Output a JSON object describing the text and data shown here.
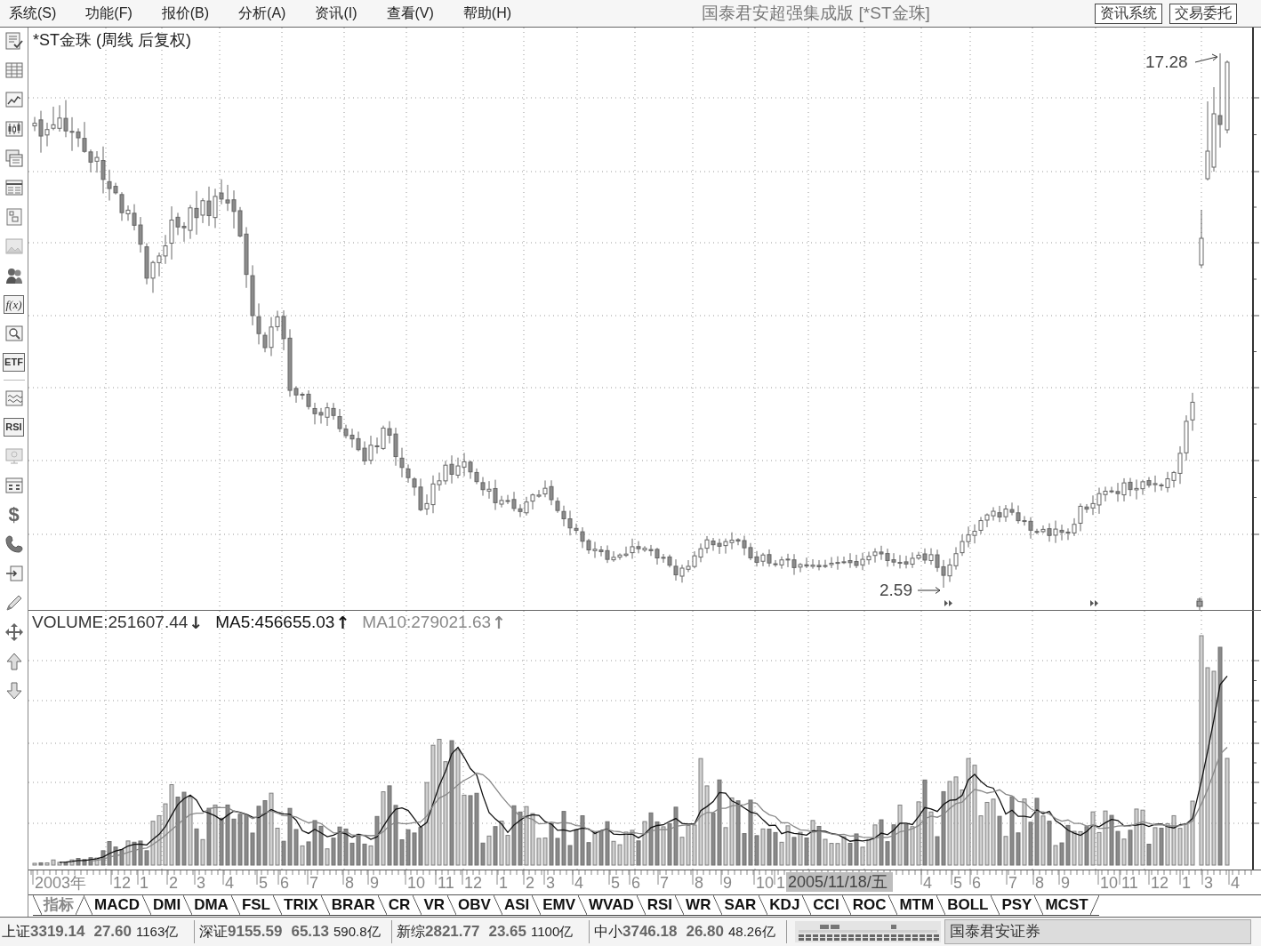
{
  "menu_bar": {
    "items": [
      "系统(S)",
      "功能(F)",
      "报价(B)",
      "分析(A)",
      "资讯(I)",
      "查看(V)",
      "帮助(H)"
    ],
    "title": "国泰君安超强集成版 [*ST金珠]",
    "buttons": [
      "资讯系统",
      "交易委托"
    ]
  },
  "toolbar": {
    "labels": [
      {
        "text": "f(x)",
        "kind": "formula"
      },
      {
        "text": "ETF",
        "kind": "tile"
      },
      {
        "text": "RSI",
        "kind": "tile"
      },
      {
        "text": "$",
        "kind": "glyph"
      }
    ]
  },
  "price_chart": {
    "title": "*ST金珠 (周线 后复权)",
    "high_label": "17.28",
    "low_label": "2.59"
  },
  "volume_chart": {
    "indicators": [
      {
        "text": "VOLUME:251607.44",
        "arrow": "↓",
        "color": "#333333"
      },
      {
        "text": "MA5:456655.03",
        "arrow": "↑",
        "color": "#111111"
      },
      {
        "text": "MA10:279021.63",
        "arrow": "↑",
        "color": "#888888"
      }
    ]
  },
  "x_axis": {
    "labels": [
      "2003年",
      "12",
      "1",
      "2",
      "3",
      "4",
      "5",
      "6",
      "7",
      "8",
      "9",
      "10",
      "11",
      "12",
      "1",
      "2",
      "3",
      "4",
      "5",
      "6",
      "7",
      "8",
      "9",
      "10",
      "1",
      "4",
      "5",
      "6",
      "7",
      "8",
      "9",
      "10",
      "11",
      "12",
      "1",
      "3",
      "4"
    ],
    "cursor_date": "2005/11/18/五"
  },
  "indicator_tabs": [
    {
      "label": "指标",
      "selected": true
    },
    {
      "label": "MACD",
      "selected": false
    },
    {
      "label": "DMI",
      "selected": false
    },
    {
      "label": "DMA",
      "selected": false
    },
    {
      "label": "FSL",
      "selected": false
    },
    {
      "label": "TRIX",
      "selected": false
    },
    {
      "label": "BRAR",
      "selected": false
    },
    {
      "label": "CR",
      "selected": false
    },
    {
      "label": "VR",
      "selected": false
    },
    {
      "label": "OBV",
      "selected": false
    },
    {
      "label": "ASI",
      "selected": false
    },
    {
      "label": "EMV",
      "selected": false
    },
    {
      "label": "WVAD",
      "selected": false
    },
    {
      "label": "RSI",
      "selected": false
    },
    {
      "label": "WR",
      "selected": false
    },
    {
      "label": "SAR",
      "selected": false
    },
    {
      "label": "KDJ",
      "selected": false
    },
    {
      "label": "CCI",
      "selected": false
    },
    {
      "label": "ROC",
      "selected": false
    },
    {
      "label": "MTM",
      "selected": false
    },
    {
      "label": "BOLL",
      "selected": false
    },
    {
      "label": "PSY",
      "selected": false
    },
    {
      "label": "MCST",
      "selected": false
    }
  ],
  "status_bar": {
    "indices": [
      {
        "name": "上证",
        "value": "3319.14",
        "change": "27.60",
        "amount": "1163亿"
      },
      {
        "name": "深证",
        "value": "9155.59",
        "change": "65.13",
        "amount": "590.8亿"
      },
      {
        "name": "新综",
        "value": "2821.77",
        "change": "23.65",
        "amount": "1100亿"
      },
      {
        "name": "中小",
        "value": "3746.18",
        "change": "26.80",
        "amount": "48.26亿"
      }
    ],
    "broker": "国泰君安证券"
  }
}
